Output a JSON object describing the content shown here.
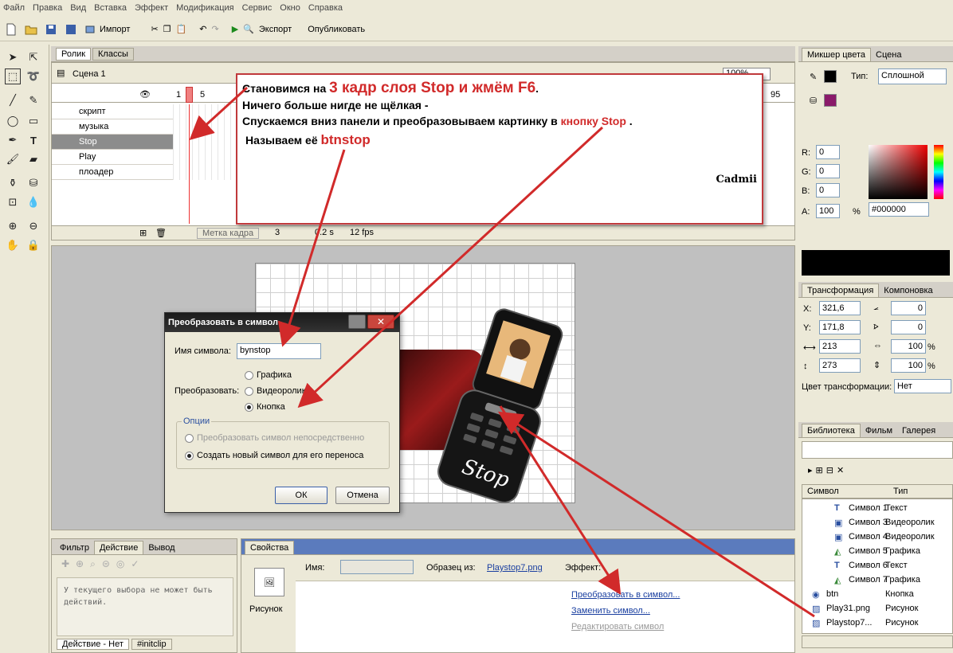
{
  "menu": [
    "Файл",
    "Правка",
    "Вид",
    "Вставка",
    "Эффект",
    "Модификация",
    "Сервис",
    "Окно",
    "Справка"
  ],
  "toolbar": {
    "import": "Импорт",
    "export": "Экспорт",
    "publish": "Опубликовать"
  },
  "timeline": {
    "tabs": [
      "Ролик",
      "Классы"
    ],
    "scene": "Сцена 1",
    "zoom": "100%",
    "frame_numbers": [
      "1",
      "5",
      "95"
    ],
    "layers": [
      "скрипт",
      "музыка",
      "Stop",
      "Play",
      "плоадер"
    ],
    "status": {
      "label": "Метка кадра",
      "frame": "3",
      "time": "0.2 s",
      "fps": "12 fps"
    }
  },
  "callout": {
    "line1_prefix": "Становимся на ",
    "line1_highlight": "3 кадр слоя Stop и жмём F6",
    "line1_suffix": ".",
    "line2": "Ничего больше нигде не щёлкая -",
    "line3_prefix": "Спускаемся вниз панели и преобразовываем картинку в ",
    "line3_highlight": "кнопку Stop",
    "line3_suffix": " .",
    "line4_prefix": "Называем её ",
    "line4_highlight": "btnstop",
    "signature": "Cadmii"
  },
  "dialog": {
    "title": "Преобразовать в символ",
    "name_label": "Имя символа:",
    "name_value": "bynstop",
    "convert_label": "Преобразовать:",
    "options": [
      "Графика",
      "Видеоролик",
      "Кнопка"
    ],
    "group_label": "Опции",
    "opt_direct": "Преобразовать символ непосредственно",
    "opt_new": "Создать новый символ для его переноса",
    "ok": "ОК",
    "cancel": "Отмена"
  },
  "actions_panel": {
    "tabs": [
      "Фильтр",
      "Действие",
      "Вывод"
    ],
    "message": "У текущего выбора не может быть действий.",
    "bottom_tabs": [
      "Действие - Нет",
      "#initclip"
    ]
  },
  "properties": {
    "tab": "Свойства",
    "type": "Рисунок",
    "name_label": "Имя:",
    "source_label": "Образец из:",
    "source_value": "Playstop7.png",
    "effect_label": "Эффект:",
    "link_convert": "Преобразовать в символ...",
    "link_replace": "Заменить символ...",
    "link_edit": "Редактировать символ"
  },
  "color_mixer": {
    "tabs": [
      "Микшер цвета",
      "Сцена"
    ],
    "type_label": "Тип:",
    "type_value": "Сплошной",
    "r": "0",
    "g": "0",
    "b": "0",
    "a": "100",
    "hex": "#000000",
    "percent": "%"
  },
  "transform": {
    "tabs": [
      "Трансформация",
      "Компоновка"
    ],
    "x": "321,6",
    "y": "171,8",
    "w": "213",
    "h": "273",
    "rot1": "0",
    "rot2": "0",
    "scale1": "100",
    "scale2": "100",
    "color_label": "Цвет трансформации:",
    "color_value": "Нет"
  },
  "library": {
    "tabs": [
      "Библиотека",
      "Фильм",
      "Галерея"
    ],
    "col_symbol": "Символ",
    "col_type": "Тип",
    "items": [
      {
        "name": "Символ 1",
        "type": "Текст",
        "icon": "text-icon"
      },
      {
        "name": "Символ 3",
        "type": "Видеоролик",
        "icon": "movie-icon"
      },
      {
        "name": "Символ 4",
        "type": "Видеоролик",
        "icon": "movie-icon"
      },
      {
        "name": "Символ 5",
        "type": "Графика",
        "icon": "graphic-icon"
      },
      {
        "name": "Символ 6",
        "type": "Текст",
        "icon": "text-icon"
      },
      {
        "name": "Символ 7",
        "type": "Графика",
        "icon": "graphic-icon"
      },
      {
        "name": "btn",
        "type": "Кнопка",
        "icon": "button-icon"
      },
      {
        "name": "Play31.png",
        "type": "Рисунок",
        "icon": "image-icon"
      },
      {
        "name": "Playstop7...",
        "type": "Рисунок",
        "icon": "image-icon"
      }
    ]
  },
  "stage": {
    "phone_logo": "Stop"
  },
  "colors": {
    "accent_red": "#d12a2a",
    "callout_border": "#c0393b"
  }
}
